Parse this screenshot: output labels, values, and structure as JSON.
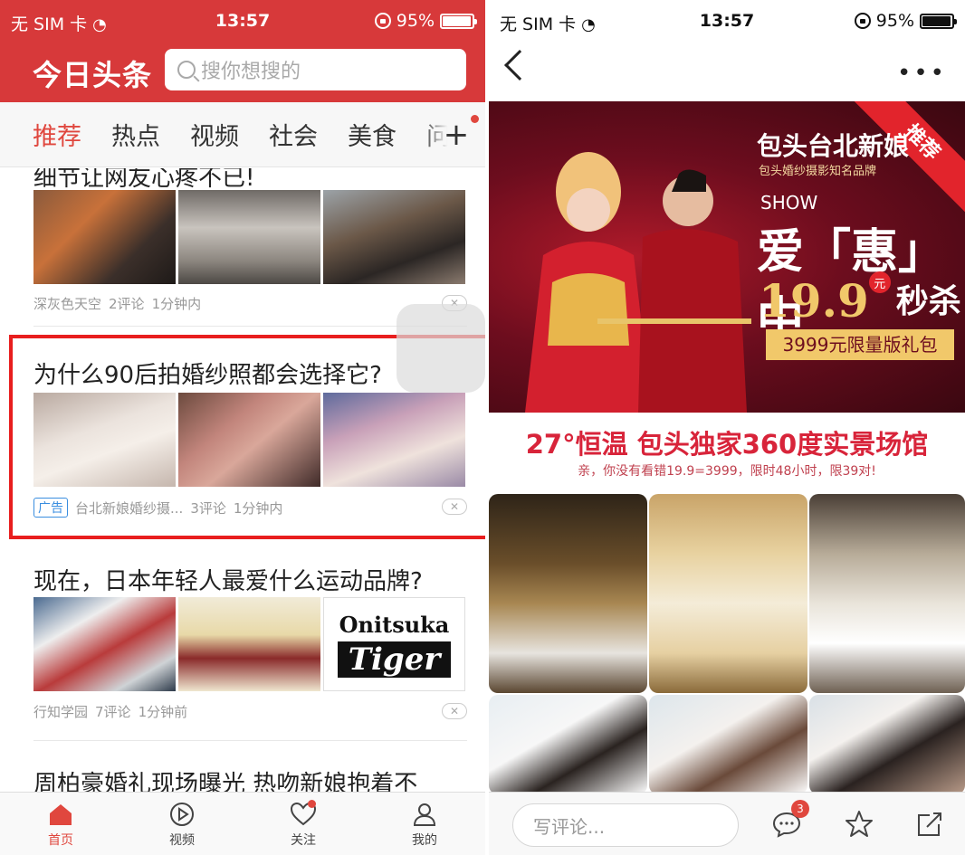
{
  "left": {
    "status": {
      "carrier": "无 SIM 卡",
      "time": "13:57",
      "battery": "95%"
    },
    "header": {
      "logo": "今日头条",
      "search_placeholder": "搜你想搜的"
    },
    "tabs": [
      {
        "label": "推荐",
        "active": true
      },
      {
        "label": "热点"
      },
      {
        "label": "视频"
      },
      {
        "label": "社会"
      },
      {
        "label": "美食"
      },
      {
        "label": "问答"
      }
    ],
    "feed": [
      {
        "title": "细节让网友心疼不已!",
        "source": "深灰色天空",
        "comments": "2评论",
        "time": "1分钟内"
      },
      {
        "title": "为什么90后拍婚纱照都会选择它?",
        "ad_label": "广告",
        "source": "台北新娘婚纱摄...",
        "comments": "3评论",
        "time": "1分钟内"
      },
      {
        "title": "现在，日本年轻人最爱什么运动品牌?",
        "source": "行知学园",
        "comments": "7评论",
        "time": "1分钟前"
      },
      {
        "title": "周柏豪婚礼现场曝光 热吻新娘抱着不"
      }
    ],
    "onitsuka": {
      "line1": "Onitsuka",
      "line2": "Tiger"
    },
    "bottom_nav": [
      {
        "label": "首页",
        "icon": "home-icon",
        "active": true
      },
      {
        "label": "视频",
        "icon": "video-icon"
      },
      {
        "label": "关注",
        "icon": "heart-icon"
      },
      {
        "label": "我的",
        "icon": "profile-icon"
      }
    ]
  },
  "right": {
    "status": {
      "carrier": "无 SIM 卡",
      "time": "13:57",
      "battery": "95%"
    },
    "banner": {
      "ribbon": "推荐",
      "brand": "包头台北新娘",
      "brand_sub": "包头婚纱摄影知名品牌",
      "show": "SHOW",
      "slogan": "爱「惠」中",
      "price": "19.9",
      "yuan": "元",
      "miaosha": "秒杀",
      "limited": "3999元限量版礼包"
    },
    "promo_title": "27°恒温 包头独家360度实景场馆",
    "promo_sub": "亲，你没有看错19.9=3999，限时48小时，限39对!",
    "comment_placeholder": "写评论...",
    "comment_badge": "3"
  },
  "colors": {
    "brand_red": "#d7393a",
    "highlight_red": "#e81e1e",
    "ad_blue": "#3a8ee0"
  }
}
